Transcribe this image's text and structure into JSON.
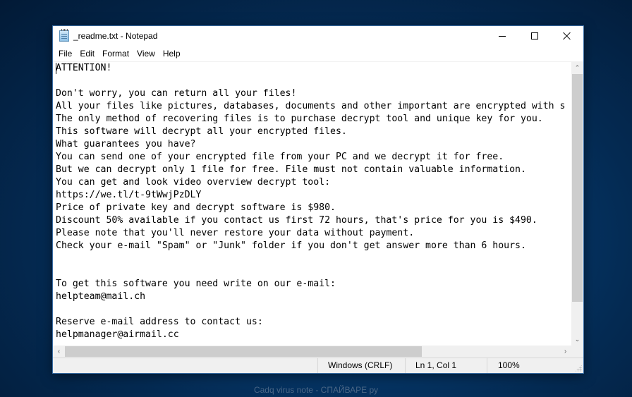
{
  "window": {
    "title": "_readme.txt - Notepad",
    "icon": "notepad-icon",
    "controls": {
      "minimize": "minimize-icon",
      "maximize": "maximize-icon",
      "close": "close-icon"
    }
  },
  "menu": {
    "items": [
      {
        "label": "File"
      },
      {
        "label": "Edit"
      },
      {
        "label": "Format"
      },
      {
        "label": "View"
      },
      {
        "label": "Help"
      }
    ]
  },
  "editor": {
    "lines": [
      "ATTENTION!",
      "",
      "Don't worry, you can return all your files!",
      "All your files like pictures, databases, documents and other important are encrypted with s",
      "The only method of recovering files is to purchase decrypt tool and unique key for you.",
      "This software will decrypt all your encrypted files.",
      "What guarantees you have?",
      "You can send one of your encrypted file from your PC and we decrypt it for free.",
      "But we can decrypt only 1 file for free. File must not contain valuable information.",
      "You can get and look video overview decrypt tool:",
      "https://we.tl/t-9tWwjPzDLY",
      "Price of private key and decrypt software is $980.",
      "Discount 50% available if you contact us first 72 hours, that's price for you is $490.",
      "Please note that you'll never restore your data without payment.",
      "Check your e-mail \"Spam\" or \"Junk\" folder if you don't get answer more than 6 hours.",
      "",
      "",
      "To get this software you need write on our e-mail:",
      "helpteam@mail.ch",
      "",
      "Reserve e-mail address to contact us:",
      "helpmanager@airmail.cc"
    ]
  },
  "scrollbars": {
    "vertical": {
      "up_icon": "chevron-up-icon",
      "down_icon": "chevron-down-icon",
      "up_glyph": "⌃",
      "down_glyph": "⌄"
    },
    "horizontal": {
      "left_icon": "chevron-left-icon",
      "right_icon": "chevron-right-icon",
      "left_glyph": "‹",
      "right_glyph": "›"
    }
  },
  "status": {
    "line_ending": "Windows (CRLF)",
    "position": "Ln 1, Col 1",
    "zoom": "100%"
  },
  "watermark": "Cadq virus note - СПАЙВАРЕ ру"
}
